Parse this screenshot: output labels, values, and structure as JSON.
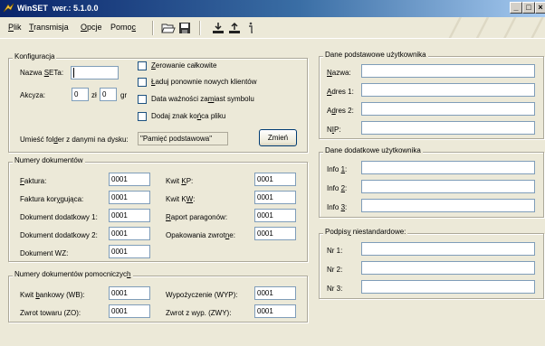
{
  "window": {
    "app": "WinSET",
    "version_label": "wer.: 5.1.0.0",
    "minimize": "_",
    "maximize": "□",
    "close": "×"
  },
  "menu": [
    {
      "ul": "P",
      "rest": "lik"
    },
    {
      "ul": "T",
      "rest": "ransmisja"
    },
    {
      "ul": "O",
      "rest": "pcje"
    },
    {
      "pre": "Pomo",
      "ul": "c"
    }
  ],
  "watermark": "/ / / /",
  "config": {
    "legend": "Konfiguracja",
    "set_name_pre": "Nazwa ",
    "set_name_ul": "S",
    "set_name_post": "ETa:",
    "set_name_value": "",
    "excise_label": "Akcyza:",
    "zl_value": "0",
    "zl_label": "zł",
    "gr_value": "0",
    "gr_label": "gr",
    "checkboxes": [
      {
        "ul": "Z",
        "rest": "erowanie całkowite"
      },
      {
        "ul": "Ł",
        "rest": "aduj ponownie nowych klientów"
      },
      {
        "pre": "Data ważności za",
        "ul": "m",
        "rest": "iast symbolu"
      },
      {
        "pre": "Dodaj znak ko",
        "ul": "ń",
        "rest": "ca pliku"
      }
    ],
    "folder_pre": "Umieść fol",
    "folder_ul": "d",
    "folder_post": "er z danymi na dysku:",
    "folder_value": "\"Pamięć podstawowa\"",
    "change_button": "Zmień"
  },
  "doc_numbers": {
    "legend": "Numery dokumentów",
    "left": [
      {
        "pre": "",
        "ul": "F",
        "rest": "aktura:",
        "value": "0001"
      },
      {
        "pre": "Faktura kor",
        "ul": "y",
        "rest": "gująca:",
        "value": "0001"
      },
      {
        "pre": "Dokument dodatkowy 1:",
        "ul": "",
        "rest": "",
        "value": "0001"
      },
      {
        "pre": "Dokument dodatkowy 2:",
        "ul": "",
        "rest": "",
        "value": "0001"
      },
      {
        "pre": "Dokument WZ:",
        "ul": "",
        "rest": "",
        "value": "0001"
      }
    ],
    "right": [
      {
        "pre": "Kwit ",
        "ul": "K",
        "rest": "P:",
        "value": "0001"
      },
      {
        "pre": "Kwit K",
        "ul": "W",
        "rest": ":",
        "value": "0001"
      },
      {
        "pre": "",
        "ul": "R",
        "rest": "aport paragonów:",
        "value": "0001"
      },
      {
        "pre": "Opakowania zwrot",
        "ul": "n",
        "rest": "e:",
        "value": "0001"
      }
    ]
  },
  "aux_numbers": {
    "legend_pre": "Numery dokumentów pomocniczyc",
    "legend_ul": "h",
    "left": [
      {
        "pre": "Kwit ",
        "ul": "b",
        "rest": "ankowy (WB):",
        "value": "0001"
      },
      {
        "pre": "Zwrot towaru (ZO):",
        "ul": "",
        "rest": "",
        "value": "0001"
      }
    ],
    "right": [
      {
        "pre": "Wypożyczenie (WYP):",
        "ul": "",
        "rest": "",
        "value": "0001"
      },
      {
        "pre": "Zwrot z wyp. (ZWY):",
        "ul": "",
        "rest": "",
        "value": "0001"
      }
    ]
  },
  "user_basic": {
    "legend": "Dane podstawowe użytkownika",
    "fields": [
      {
        "pre": "",
        "ul": "N",
        "rest": "azwa:",
        "value": ""
      },
      {
        "pre": "",
        "ul": "A",
        "rest": "dres 1:",
        "value": ""
      },
      {
        "pre": "A",
        "ul": "d",
        "rest": "res 2:",
        "value": ""
      },
      {
        "pre": "N",
        "ul": "I",
        "rest": "P:",
        "value": ""
      }
    ]
  },
  "user_extra": {
    "legend": "Dane dodatkowe użytkownika",
    "fields": [
      {
        "pre": "Info ",
        "ul": "1",
        "rest": ":",
        "value": ""
      },
      {
        "pre": "Info ",
        "ul": "2",
        "rest": ":",
        "value": ""
      },
      {
        "pre": "Info ",
        "ul": "3",
        "rest": ":",
        "value": ""
      }
    ]
  },
  "signatures": {
    "legend_pre": "Podpis",
    "legend_ul": "y",
    "legend_post": " niestandardowe:",
    "fields": [
      {
        "label": "Nr 1:",
        "value": ""
      },
      {
        "label": "Nr 2:",
        "value": ""
      },
      {
        "label": "Nr 3:",
        "value": ""
      }
    ]
  },
  "colors": {
    "titlebar": "#0a246a",
    "face": "#ece9d8",
    "input_border": "#7f9db9"
  }
}
